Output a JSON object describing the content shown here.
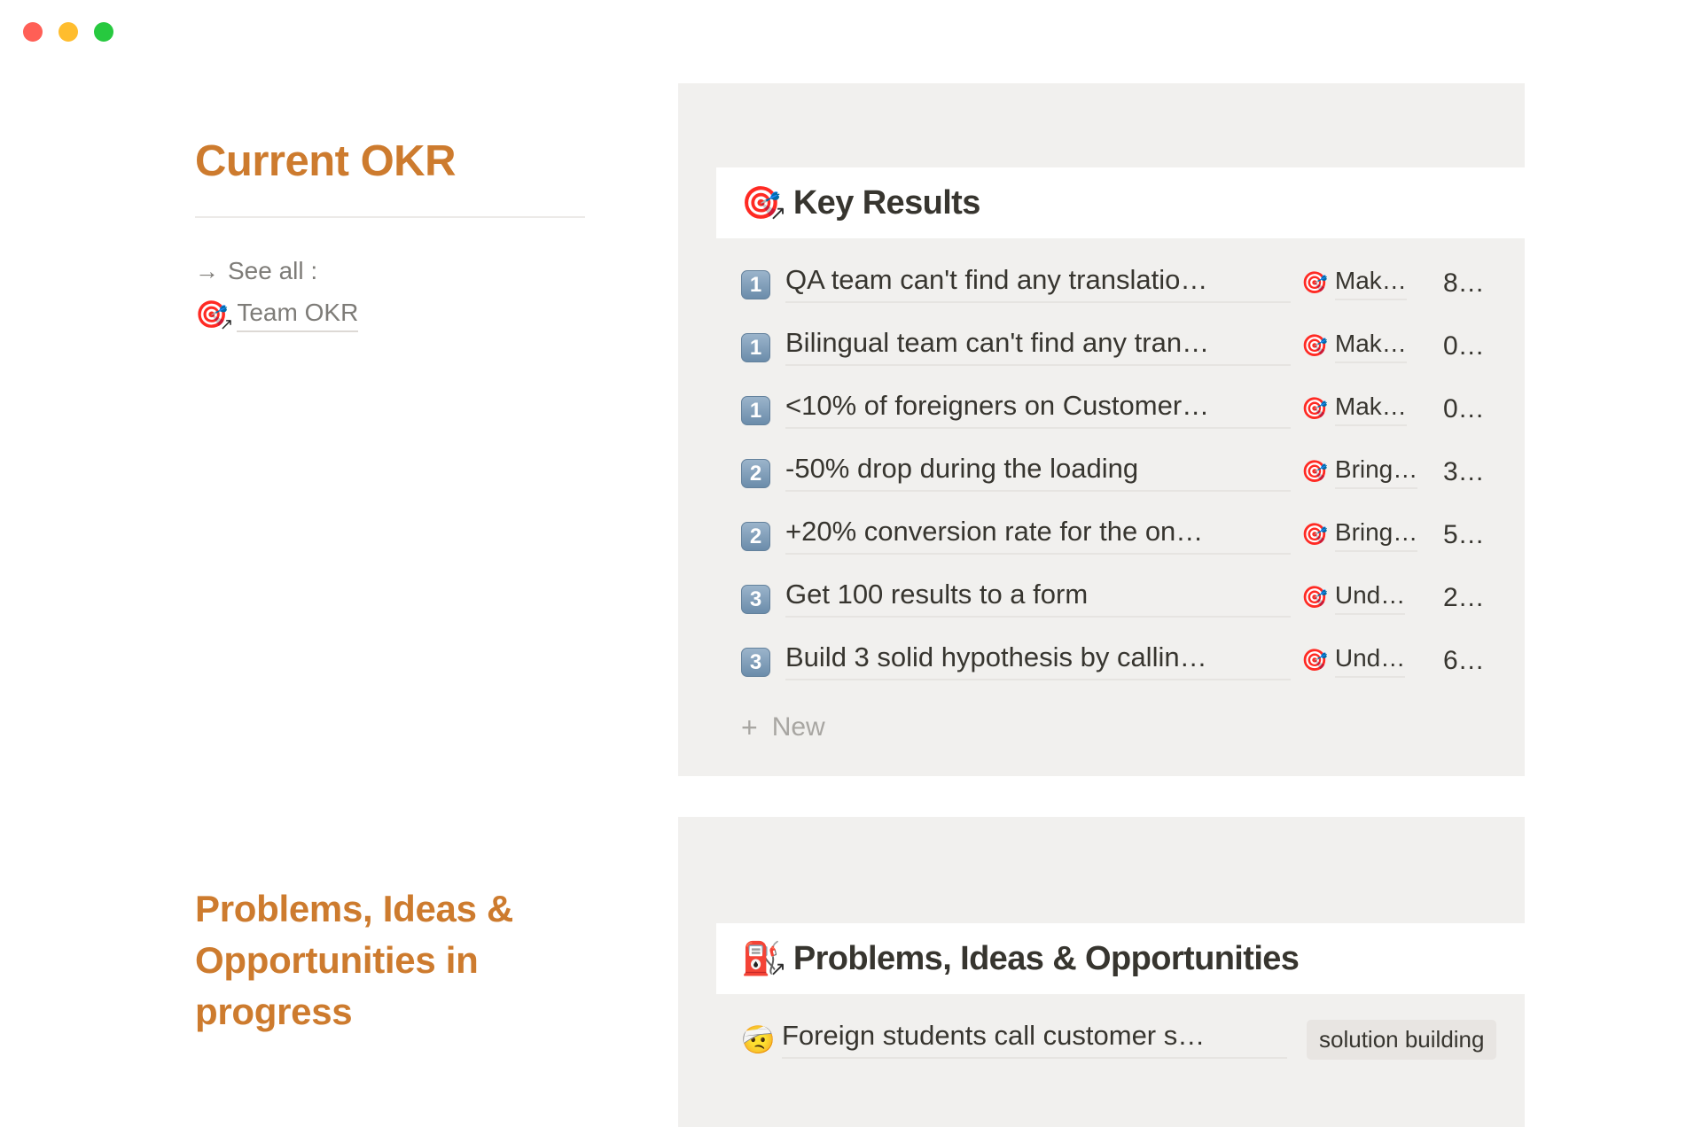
{
  "window": {
    "controls": [
      {
        "name": "close",
        "color": "#ff5f56"
      },
      {
        "name": "minimize",
        "color": "#ffbd2e"
      },
      {
        "name": "maximize",
        "color": "#27c93f"
      }
    ]
  },
  "left": {
    "okr_heading": "Current OKR",
    "see_all_arrow": "→",
    "see_all_label": "See all :",
    "team_okr_emoji": "🎯",
    "team_okr_label": "Team OKR",
    "pio_heading": "Problems, Ideas & Opportunities in progress"
  },
  "key_results_card": {
    "header_emoji": "🎯",
    "header_title": "Key Results",
    "link_arrow": "↗",
    "new_label": "New",
    "plus_icon": "+",
    "rows": [
      {
        "keycap": "1",
        "title": "QA team can't find any translatio…",
        "relation_emoji": "🎯",
        "relation": "Mak…",
        "value": "8…"
      },
      {
        "keycap": "1",
        "title": "Bilingual team can't find any tran…",
        "relation_emoji": "🎯",
        "relation": "Mak…",
        "value": "0…"
      },
      {
        "keycap": "1",
        "title": "<10% of foreigners on Customer…",
        "relation_emoji": "🎯",
        "relation": "Mak…",
        "value": "0…"
      },
      {
        "keycap": "2",
        "title": "-50% drop during the loading",
        "relation_emoji": "🎯",
        "relation": "Bring…",
        "value": "3…"
      },
      {
        "keycap": "2",
        "title": "+20% conversion rate for the on…",
        "relation_emoji": "🎯",
        "relation": "Bring…",
        "value": "5…"
      },
      {
        "keycap": "3",
        "title": "Get 100 results to a form",
        "relation_emoji": "🎯",
        "relation": "Und…",
        "value": "2…"
      },
      {
        "keycap": "3",
        "title": "Build 3 solid hypothesis by callin…",
        "relation_emoji": "🎯",
        "relation": "Und…",
        "value": "6…"
      }
    ]
  },
  "problems_card": {
    "header_emoji": "⛽",
    "header_title": "Problems, Ideas & Opportunities",
    "link_arrow": "↗",
    "rows": [
      {
        "emoji": "🤕",
        "title": "Foreign students call customer s…",
        "tag": "solution building"
      }
    ]
  },
  "colors": {
    "accent": "#cd7b2e",
    "card_bg": "#f1f0ee",
    "text": "#37352f",
    "muted": "#7e7c78",
    "tag_bg": "#e8e5e2"
  }
}
